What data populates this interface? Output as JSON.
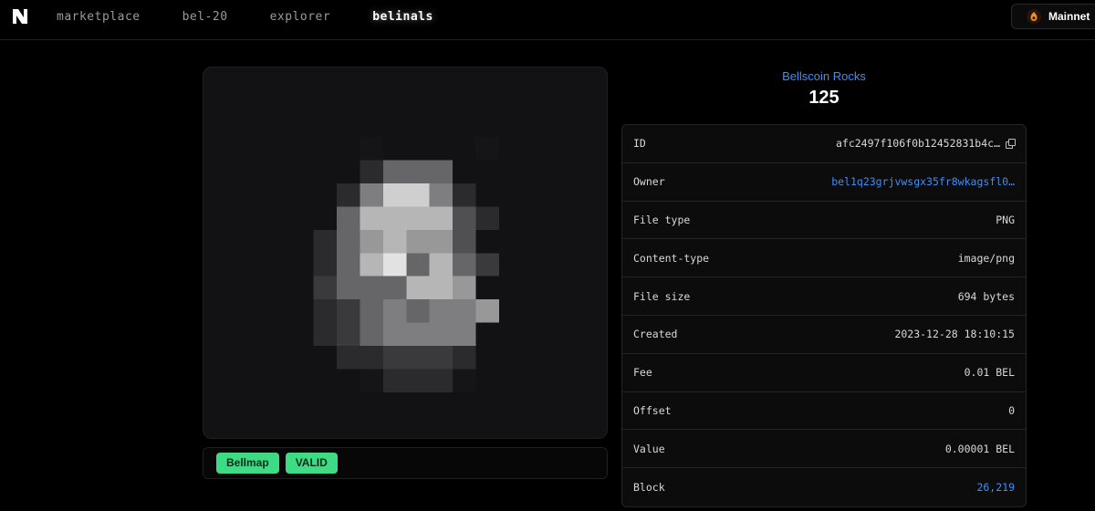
{
  "nav": {
    "items": [
      {
        "label": "marketplace",
        "active": false
      },
      {
        "label": "bel-20",
        "active": false
      },
      {
        "label": "explorer",
        "active": false
      },
      {
        "label": "belinals",
        "active": true
      }
    ],
    "network_label": "Mainnet",
    "network_icon": "bellscoin-icon"
  },
  "inscription": {
    "collection": "Bellscoin Rocks",
    "number": "125",
    "image_icon": "pixel-rock-image",
    "tags": [
      "Bellmap",
      "VALID"
    ],
    "details": [
      {
        "key": "ID",
        "value": "afc2497f106f0b12452831b4c…"
      },
      {
        "key": "Owner",
        "value": "bel1q23grjvwsgx35fr8wkagsfl0…"
      },
      {
        "key": "File type",
        "value": "PNG"
      },
      {
        "key": "Content-type",
        "value": "image/png"
      },
      {
        "key": "File size",
        "value": "694 bytes"
      },
      {
        "key": "Created",
        "value": "2023-12-28 18:10:15"
      },
      {
        "key": "Fee",
        "value": "0.01 BEL"
      },
      {
        "key": "Offset",
        "value": "0"
      },
      {
        "key": "Value",
        "value": "0.00001 BEL"
      },
      {
        "key": "Block",
        "value": "26,219"
      }
    ]
  },
  "colors": {
    "accent_link": "#3f8ef5",
    "tag_green": "#3ddc84",
    "background": "#000000"
  }
}
